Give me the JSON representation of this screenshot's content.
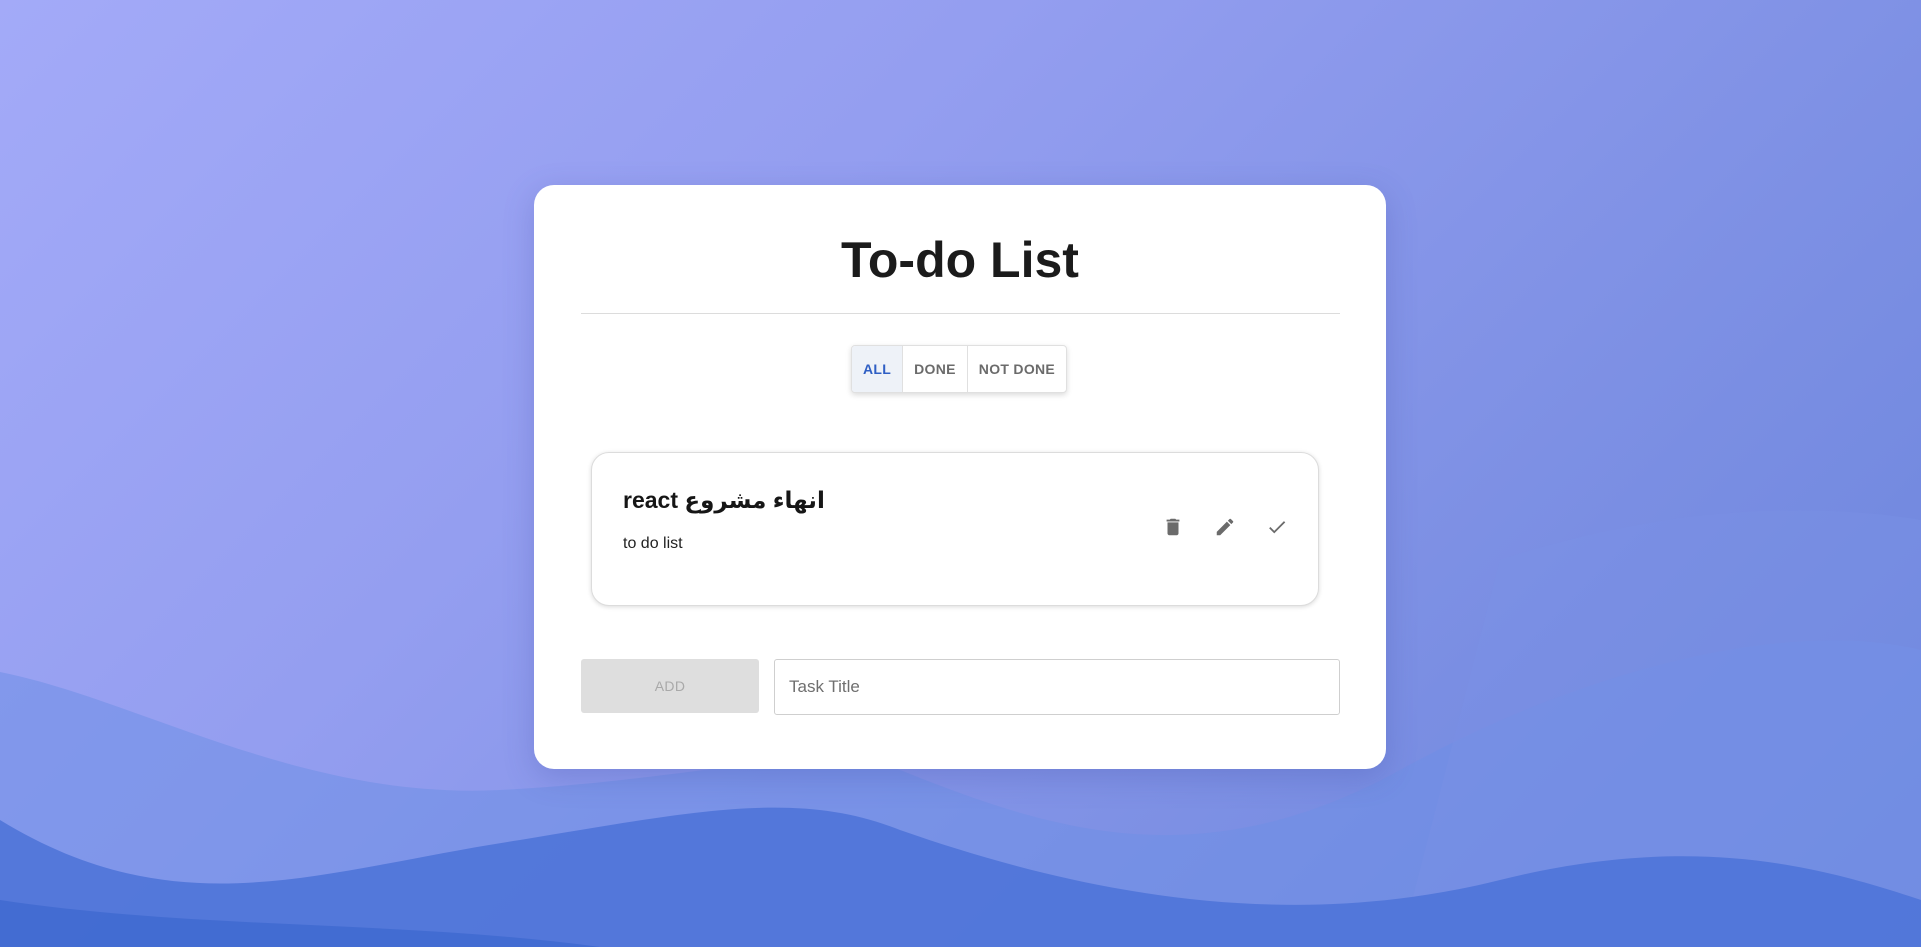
{
  "app": {
    "title": "To-do List"
  },
  "filters": {
    "items": [
      {
        "label": "ALL",
        "active": true
      },
      {
        "label": "DONE",
        "active": false
      },
      {
        "label": "NOT DONE",
        "active": false
      }
    ]
  },
  "tasks": [
    {
      "title": "react انهاء مشروع",
      "description": "to do list",
      "actions": {
        "delete_icon": "trash-icon",
        "edit_icon": "pencil-icon",
        "done_icon": "check-icon"
      }
    }
  ],
  "composer": {
    "add_label": "ADD",
    "input_placeholder": "Task Title",
    "input_value": ""
  },
  "colors": {
    "accent": "#2f5fc4",
    "icon": "#6b6b6b",
    "background_top": "#a3aaf8",
    "background_bottom": "#4f74d8"
  }
}
